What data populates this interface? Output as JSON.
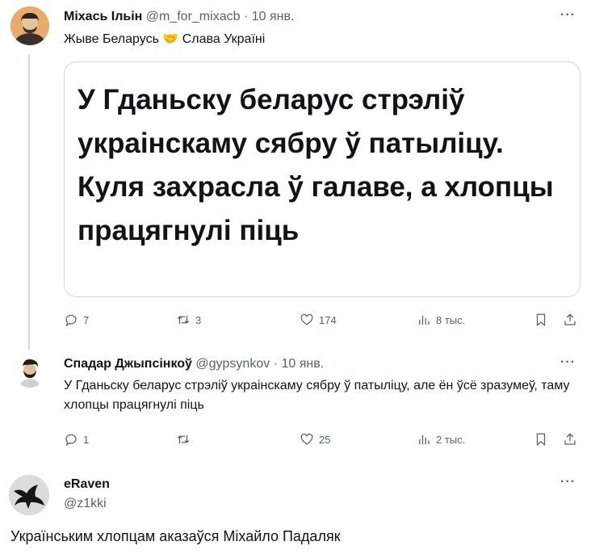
{
  "tweet1": {
    "name": "Міхась Ільін",
    "handle": "@m_for_mixacb",
    "separator": "·",
    "date": "10 янв.",
    "text_part1": "Жыве Беларусь",
    "text_emoji": "🤝",
    "text_part2": "Слава Україні",
    "card_headline": "У Гданьску беларус стрэліў украінскаму сябру ў патыліцу. Куля захрасла ў галаве, а хлопцы працягнулі піць",
    "replies": "7",
    "retweets": "3",
    "likes": "174",
    "views": "8 тыс.",
    "more": "···"
  },
  "tweet2": {
    "name": "Спадар Джыпсінкоў",
    "handle": "@gypsynkov",
    "separator": "·",
    "date": "10 янв.",
    "text": "У Гданьску беларус стрэліў украінскаму сябру ў патыліцу, але ён ўсё зразумеў, таму хлопцы працягнулі піць",
    "replies": "1",
    "retweets": "",
    "likes": "25",
    "views": "2 тыс.",
    "more": "···"
  },
  "tweet3": {
    "name": "eRaven",
    "handle": "@z1kki",
    "more": "···",
    "text": "Українським хлопцам аказаўся Міхайло Падаляк"
  },
  "icons": [
    "reply-icon",
    "retweet-icon",
    "like-icon",
    "views-icon",
    "bookmark-icon",
    "share-icon",
    "more-icon"
  ],
  "colors": {
    "text": "#0f1419",
    "secondary": "#536471",
    "border": "#cfd9de"
  }
}
